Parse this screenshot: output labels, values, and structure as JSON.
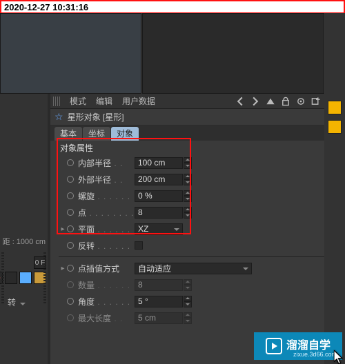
{
  "datetime": "2020-12-27 10:31:16",
  "menu": {
    "mode": "模式",
    "edit": "编辑",
    "userdata": "用户数据"
  },
  "object": {
    "title": "星形对象 [星形]"
  },
  "tabs": {
    "basic": "基本",
    "coord": "坐标",
    "object": "对象"
  },
  "section": {
    "obj_props": "对象属性"
  },
  "props": {
    "inner_radius": {
      "label": "内部半径",
      "value": "100 cm"
    },
    "outer_radius": {
      "label": "外部半径",
      "value": "200 cm"
    },
    "twist": {
      "label": "螺旋",
      "value": "0 %"
    },
    "points": {
      "label": "点",
      "value": "8"
    },
    "plane": {
      "label": "平面",
      "value": "XZ"
    },
    "reverse": {
      "label": "反转",
      "value": ""
    },
    "interp": {
      "label": "点插值方式",
      "value": "自动适应"
    },
    "number": {
      "label": "数量",
      "value": "8"
    },
    "angle": {
      "label": "角度",
      "value": "5 °"
    },
    "maxlen": {
      "label": "最大长度",
      "value": "5 cm"
    }
  },
  "left": {
    "readout": "距 : 1000 cm",
    "zero": "0 F",
    "rot": "转"
  },
  "watermark": {
    "text": "溜溜自学",
    "sub": "zixue.3d66.com"
  }
}
